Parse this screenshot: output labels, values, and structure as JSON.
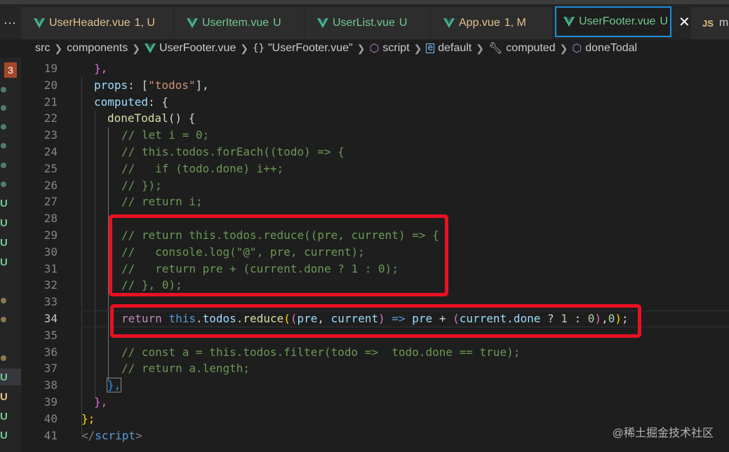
{
  "tabs": [
    {
      "name": "UserHeader.vue",
      "status": "1, U",
      "icon": "vue-icon"
    },
    {
      "name": "UserItem.vue",
      "status": "U",
      "icon": "vue-icon"
    },
    {
      "name": "UserList.vue",
      "status": "U",
      "icon": "vue-icon"
    },
    {
      "name": "App.vue",
      "status": "1, M",
      "icon": "vue-icon"
    },
    {
      "name": "UserFooter.vue",
      "status": "U",
      "icon": "vue-icon",
      "active": true,
      "close": "✕"
    },
    {
      "name": "mi",
      "icon": "js-icon",
      "glyph": "JS"
    }
  ],
  "breadcrumb": {
    "src": "src",
    "components": "components",
    "file": "UserFooter.vue",
    "braces": "{}",
    "object": "\"UserFooter.vue\"",
    "script": "script",
    "default": "default",
    "computed": "computed",
    "method": "doneTodal"
  },
  "problems_badge": "3",
  "gutter_status": [
    "U",
    "U",
    "U",
    "U",
    "U",
    "U",
    "U",
    "U"
  ],
  "line_numbers": [
    "19",
    "20",
    "21",
    "22",
    "23",
    "24",
    "25",
    "26",
    "27",
    "28",
    "29",
    "30",
    "31",
    "32",
    "33",
    "34",
    "35",
    "36",
    "37",
    "38",
    "39",
    "40",
    "41"
  ],
  "current_line": "34",
  "code": {
    "l19": "},",
    "l20_key": "props",
    "l20_rest": ": [",
    "l20_str": "\"todos\"",
    "l20_end": "],",
    "l21_key": "computed",
    "l21_rest": ": {",
    "l22_fn": "doneTodal",
    "l22_rest": "() {",
    "l23": "// let i = 0;",
    "l24": "// this.todos.forEach((todo) => {",
    "l25": "//   if (todo.done) i++;",
    "l26": "// });",
    "l27": "// return i;",
    "l29": "// return this.todos.reduce((pre, current) => {",
    "l30": "//   console.log(\"@\", pre, current);",
    "l31": "//   return pre + (current.done ? 1 : 0);",
    "l32": "// }, 0);",
    "l34_return": "return",
    "l34_this": "this",
    "l34_todos": "todos",
    "l34_reduce": "reduce",
    "l34_pre": "pre",
    "l34_current": "current",
    "l34_arrow": " => ",
    "l34_pre2": "pre",
    "l34_plus": " + ",
    "l34_current2": "current",
    "l34_done": "done",
    "l34_q": " ? ",
    "l34_one": "1",
    "l34_colon": " : ",
    "l34_zero": "0",
    "l34_zero2": "0",
    "l36": "// const a = this.todos.filter(todo =>  todo.done == true);",
    "l37": "// return a.length;",
    "l38": "},",
    "l39": "},",
    "l40": "};",
    "l41_open": "</",
    "l41_tag": "script",
    "l41_close": ">"
  },
  "watermark": "@稀土掘金技术社区",
  "colors": {
    "accent": "#1a8fd8",
    "highlight_box": "#e81123",
    "untracked": "#73c991",
    "warning": "#e2c08d",
    "comment": "#6a9955"
  }
}
